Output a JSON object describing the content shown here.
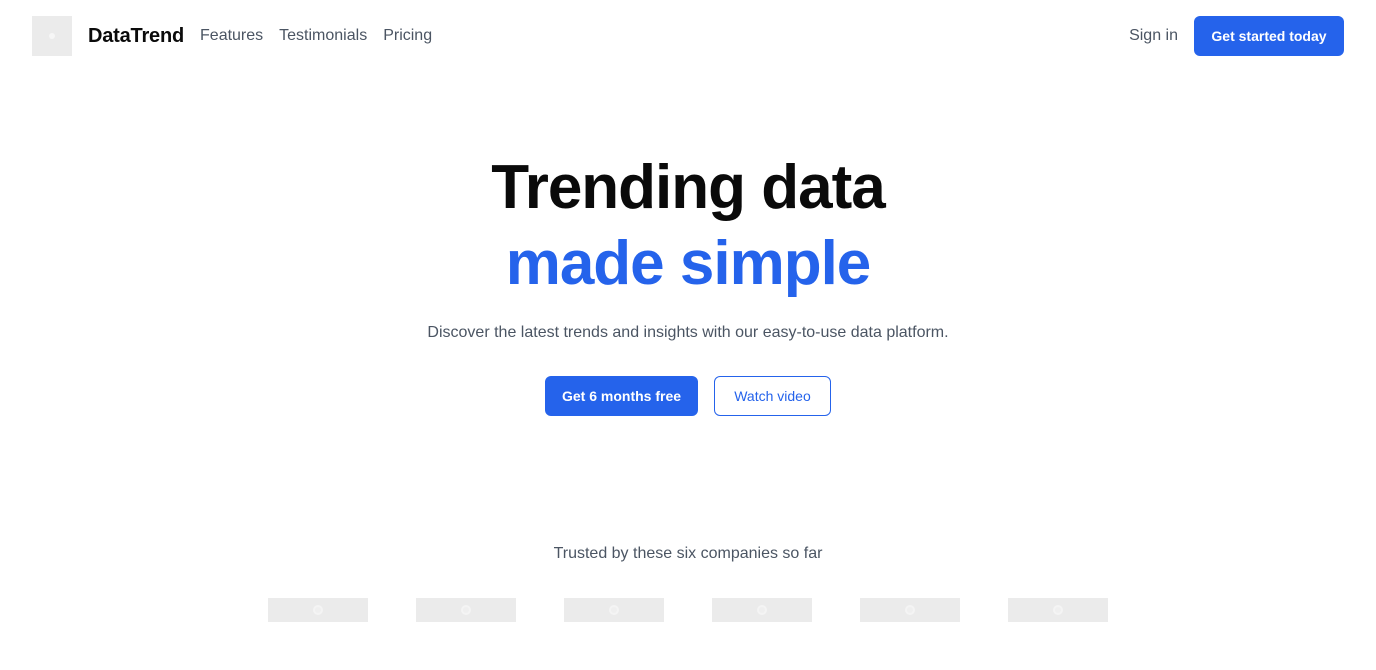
{
  "header": {
    "brand": "DataTrend",
    "nav": [
      "Features",
      "Testimonials",
      "Pricing"
    ],
    "sign_in": "Sign in",
    "cta": "Get started today"
  },
  "hero": {
    "headline_line1": "Trending data",
    "headline_line2": "made simple",
    "subtitle": "Discover the latest trends and insights with our easy-to-use data platform.",
    "primary_button": "Get 6 months free",
    "secondary_button": "Watch video"
  },
  "trusted": {
    "text": "Trusted by these six companies so far",
    "logo_count": 6
  },
  "colors": {
    "accent": "#2563eb",
    "text_muted": "#4b5563",
    "placeholder": "#ebebeb"
  }
}
